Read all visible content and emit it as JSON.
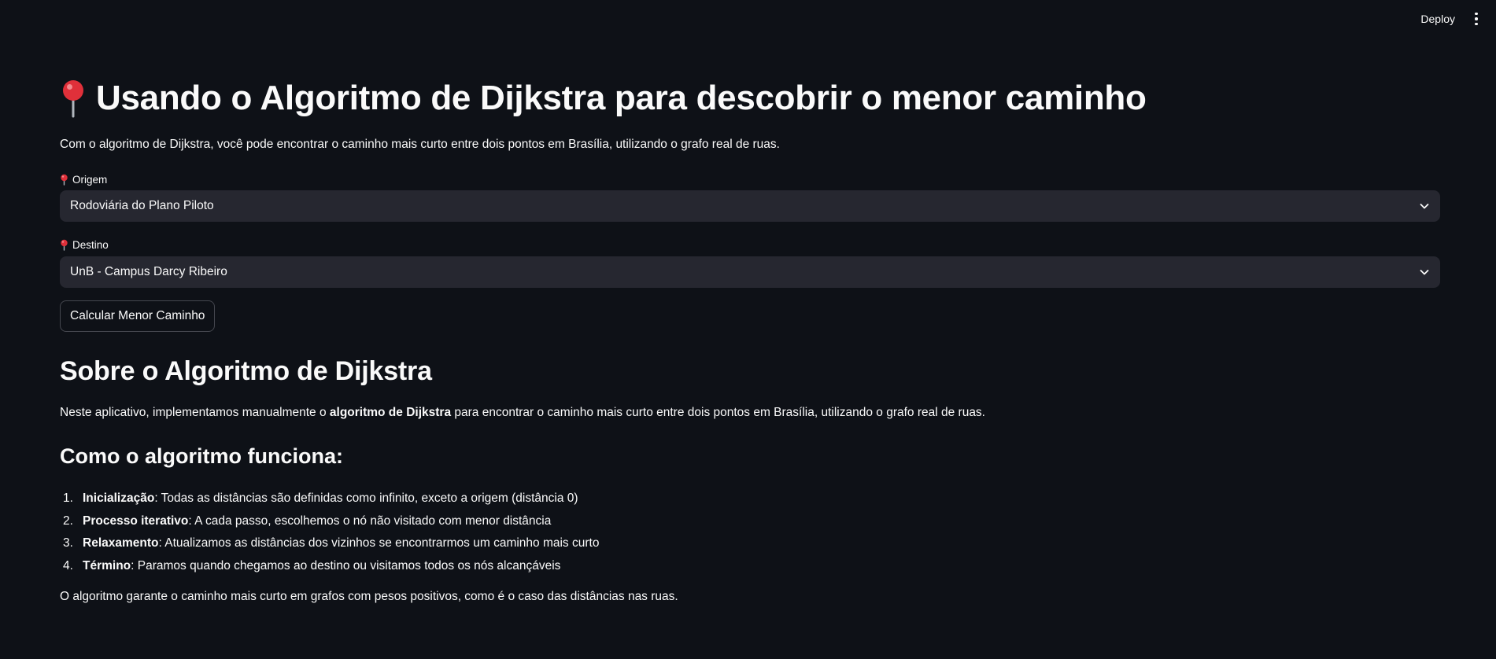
{
  "topbar": {
    "deploy_label": "Deploy",
    "menu_icon": "vertical-ellipsis-icon"
  },
  "header": {
    "icon": "round-pushpin-icon",
    "title": "Usando o Algoritmo de Dijkstra para descobrir o menor caminho"
  },
  "intro": "Com o algoritmo de Dijkstra, você pode encontrar o caminho mais curto entre dois pontos em Brasília, utilizando o grafo real de ruas.",
  "origin": {
    "label": "Origem",
    "value": "Rodoviária do Plano Piloto"
  },
  "destination": {
    "label": "Destino",
    "value": "UnB - Campus Darcy Ribeiro"
  },
  "calculate_button": "Calcular Menor Caminho",
  "about": {
    "heading": "Sobre o Algoritmo de Dijkstra",
    "text_before": "Neste aplicativo, implementamos manualmente o ",
    "text_bold": "algoritmo de Dijkstra",
    "text_after": " para encontrar o caminho mais curto entre dois pontos em Brasília, utilizando o grafo real de ruas."
  },
  "how": {
    "heading": "Como o algoritmo funciona:",
    "steps": [
      {
        "num": "1.",
        "title": "Inicialização",
        "text": ": Todas as distâncias são definidas como infinito, exceto a origem (distância 0)"
      },
      {
        "num": "2.",
        "title": "Processo iterativo",
        "text": ": A cada passo, escolhemos o nó não visitado com menor distância"
      },
      {
        "num": "3.",
        "title": "Relaxamento",
        "text": ": Atualizamos as distâncias dos vizinhos se encontrarmos um caminho mais curto"
      },
      {
        "num": "4.",
        "title": "Término",
        "text": ": Paramos quando chegamos ao destino ou visitamos todos os nós alcançáveis"
      }
    ],
    "conclusion": "O algoritmo garante o caminho mais curto em grafos com pesos positivos, como é o caso das distâncias nas ruas."
  },
  "colors": {
    "background": "#0e1117",
    "select_background": "#262730",
    "text": "#fafafa",
    "pin_red": "#e0303a"
  }
}
